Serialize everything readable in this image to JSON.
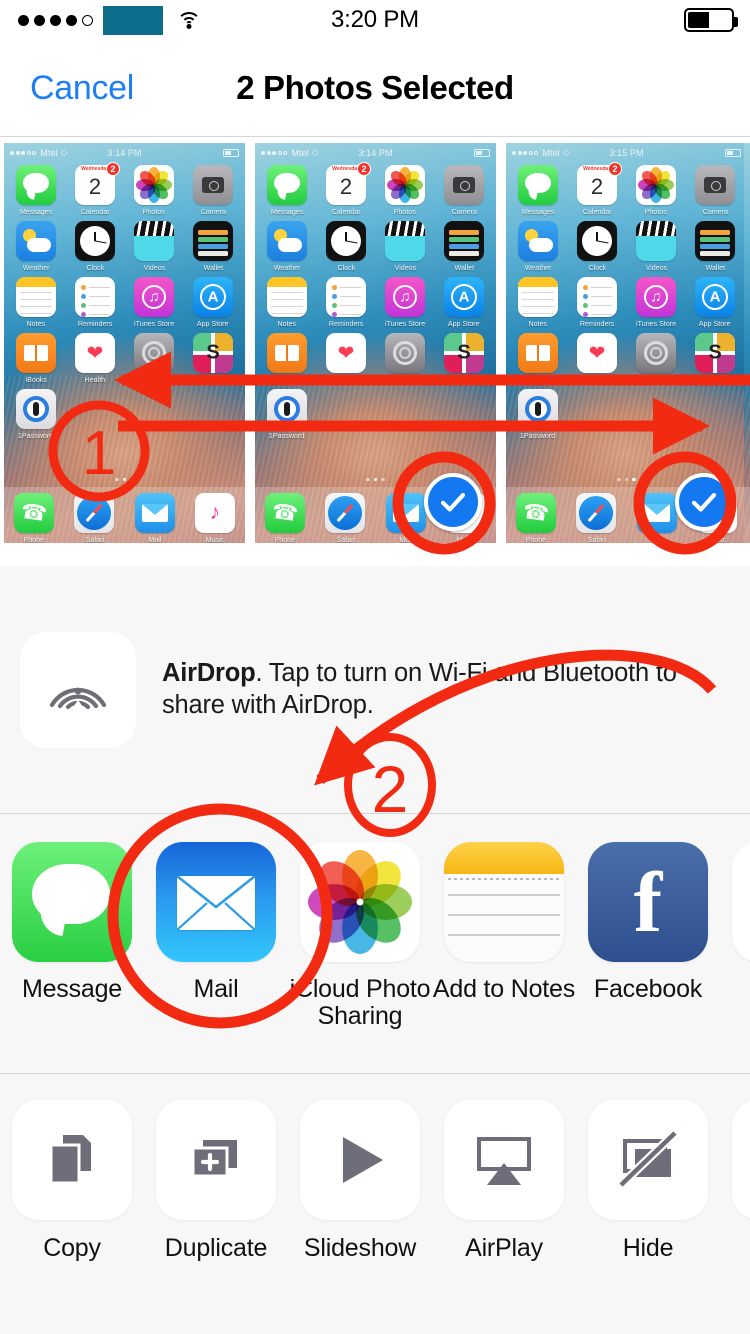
{
  "status_bar": {
    "signal_dots_filled": 4,
    "signal_dots_total": 5,
    "carrier_redacted": true,
    "carrier_redact_color": "#0d6e8c",
    "wifi_icon": "wifi-icon",
    "time": "3:20 PM",
    "battery_percent": 45
  },
  "nav": {
    "cancel_label": "Cancel",
    "title": "2 Photos Selected"
  },
  "photo_strip": {
    "thumbnails": [
      {
        "id": "photo-1",
        "time": "3:14 PM",
        "carrier": "Mtel",
        "selected": false,
        "page_dot_index": 1
      },
      {
        "id": "photo-2",
        "time": "3:14 PM",
        "carrier": "Mtel",
        "selected": true,
        "page_dot_index": 1
      },
      {
        "id": "photo-3",
        "time": "3:15 PM",
        "carrier": "Mtel",
        "selected": true,
        "page_dot_index": 2
      },
      {
        "id": "photo-4",
        "time": "",
        "carrier": "",
        "selected": false,
        "page_dot_index": 0
      }
    ],
    "home_screen": {
      "rows": [
        [
          {
            "name": "Messages",
            "icon": "messages-icon",
            "badge": ""
          },
          {
            "name": "Calendar",
            "icon": "calendar-icon",
            "badge": "2",
            "weekday": "Wednesday",
            "day": "2"
          },
          {
            "name": "Photos",
            "icon": "photos-icon",
            "badge": ""
          },
          {
            "name": "Camera",
            "icon": "camera-icon",
            "badge": ""
          }
        ],
        [
          {
            "name": "Weather",
            "icon": "weather-icon",
            "badge": ""
          },
          {
            "name": "Clock",
            "icon": "clock-icon",
            "badge": ""
          },
          {
            "name": "Videos",
            "icon": "videos-icon",
            "badge": ""
          },
          {
            "name": "Wallet",
            "icon": "wallet-icon",
            "badge": ""
          }
        ],
        [
          {
            "name": "Notes",
            "icon": "notes-icon",
            "badge": ""
          },
          {
            "name": "Reminders",
            "icon": "reminders-icon",
            "badge": ""
          },
          {
            "name": "iTunes Store",
            "icon": "itunes-icon",
            "badge": ""
          },
          {
            "name": "App Store",
            "icon": "appstore-icon",
            "badge": ""
          }
        ],
        [
          {
            "name": "iBooks",
            "icon": "ibooks-icon",
            "badge": ""
          },
          {
            "name": "Health",
            "icon": "health-icon",
            "badge": ""
          },
          {
            "name": "Settings",
            "icon": "settings-icon",
            "badge": ""
          },
          {
            "name": "Slack",
            "icon": "slack-icon",
            "badge": ""
          }
        ],
        [
          {
            "name": "1Password",
            "icon": "1password-icon",
            "badge": ""
          }
        ]
      ],
      "dock": [
        {
          "name": "Phone",
          "icon": "phone-icon"
        },
        {
          "name": "Safari",
          "icon": "safari-icon"
        },
        {
          "name": "Mail",
          "icon": "mail-icon"
        },
        {
          "name": "Music",
          "icon": "music-icon"
        }
      ]
    }
  },
  "airdrop": {
    "icon": "airdrop-icon",
    "title": "AirDrop",
    "description": ". Tap to turn on Wi-Fi and Bluetooth to share with AirDrop."
  },
  "share_apps": [
    {
      "label": "Message",
      "icon": "message-app-icon"
    },
    {
      "label": "Mail",
      "icon": "mail-app-icon"
    },
    {
      "label": "iCloud Photo Sharing",
      "icon": "icloud-photo-sharing-icon"
    },
    {
      "label": "Add to Notes",
      "icon": "notes-app-icon"
    },
    {
      "label": "Facebook",
      "icon": "facebook-app-icon"
    }
  ],
  "actions": [
    {
      "label": "Copy",
      "icon": "copy-icon"
    },
    {
      "label": "Duplicate",
      "icon": "duplicate-icon"
    },
    {
      "label": "Slideshow",
      "icon": "slideshow-icon"
    },
    {
      "label": "AirPlay",
      "icon": "airplay-icon"
    },
    {
      "label": "Hide",
      "icon": "hide-icon"
    }
  ],
  "annotations": {
    "color": "#f22a12",
    "markers": [
      {
        "label": "1",
        "target": "photo-strip-scroll"
      },
      {
        "label": "2",
        "target": "share-app-row"
      }
    ],
    "circled_targets": [
      "photo-2-checkmark",
      "photo-3-checkmark",
      "mail-app-icon"
    ]
  },
  "colors": {
    "accent_blue": "#1f7df5",
    "selection_blue": "#1478f0",
    "annotation_red": "#f22a12",
    "sheet_background": "#f7f7f8",
    "separator": "#d6d6da"
  }
}
